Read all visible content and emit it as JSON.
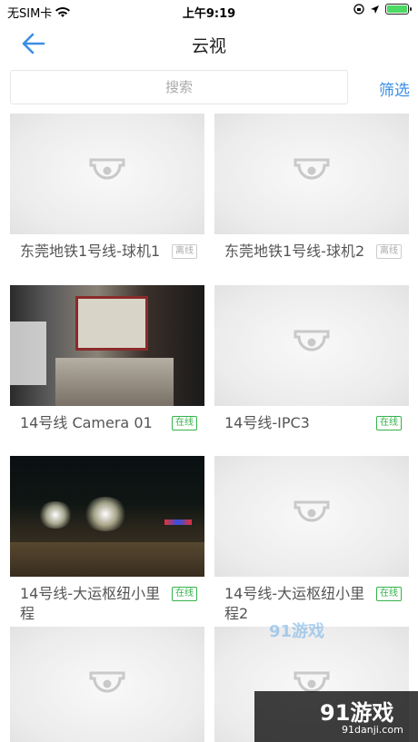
{
  "status_bar": {
    "carrier": "无SIM卡",
    "time": "上午9:19"
  },
  "nav": {
    "title": "云视"
  },
  "search": {
    "placeholder": "搜索",
    "filter_label": "筛选"
  },
  "cameras": [
    {
      "name": "东莞地铁1号线-球机1",
      "status": "离线"
    },
    {
      "name": "东莞地铁1号线-球机2",
      "status": "离线"
    },
    {
      "name": "14号线 Camera 01",
      "status": "在线"
    },
    {
      "name": "14号线-IPC3",
      "status": "在线"
    },
    {
      "name": "14号线-大运枢纽小里程",
      "status": "在线"
    },
    {
      "name": "14号线-大运枢纽小里程2",
      "status": "在线"
    }
  ],
  "colors": {
    "accent": "#3a8ee6",
    "online": "#34b34a",
    "offline": "#aaaaaa"
  },
  "watermark": {
    "site": "91游戏",
    "url": "91danji.com"
  }
}
